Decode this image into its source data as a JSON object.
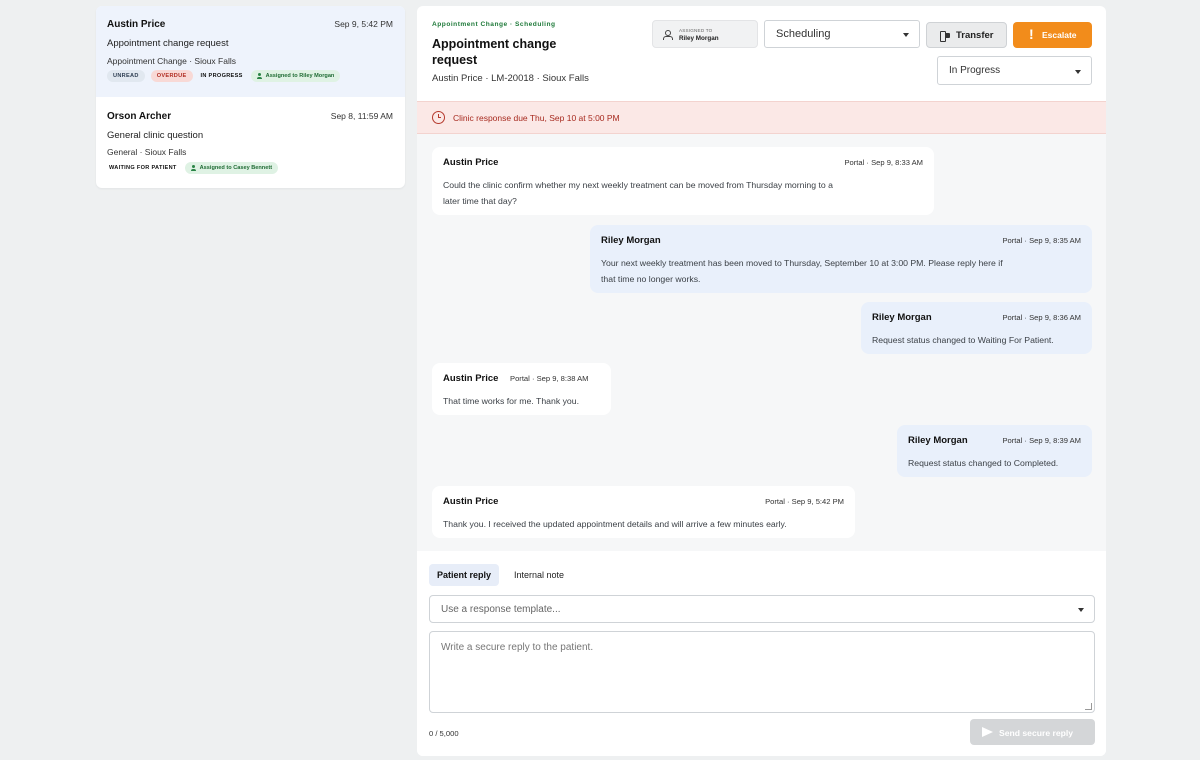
{
  "conversations": [
    {
      "name": "Austin Price",
      "time": "Sep 9, 5:42 PM",
      "subject": "Appointment change request",
      "meta": "Appointment Change · Sioux Falls",
      "badges": {
        "unread": "UNREAD",
        "overdue": "OVERDUE",
        "status": "IN PROGRESS",
        "assigned": "Assigned to Riley Morgan"
      }
    },
    {
      "name": "Orson Archer",
      "time": "Sep 8, 11:59 AM",
      "subject": "General clinic question",
      "meta": "General · Sioux Falls",
      "badges": {
        "status": "WAITING FOR PATIENT",
        "assigned": "Assigned to Casey Bennett"
      }
    }
  ],
  "header": {
    "category": "Appointment Change · Scheduling",
    "title": "Appointment change request",
    "patient": "Austin Price",
    "record": "LM-20018",
    "location": "Sioux Falls",
    "assigned_label": "ASSIGNED TO",
    "assigned_value": "Riley Morgan",
    "queue_value": "Scheduling",
    "transfer_label": "Transfer",
    "escalate_label": "Escalate",
    "status_value": "In Progress"
  },
  "alert": {
    "text": "Clinic response due Thu, Sep 10 at 5:00 PM"
  },
  "messages": [
    {
      "from": "Austin Price",
      "when": "Portal · Sep 9, 8:33 AM",
      "lines": [
        "Could the clinic confirm whether my next weekly treatment can be moved from Thursday morning to a",
        "later time that day?"
      ]
    },
    {
      "from": "Riley Morgan",
      "when": "Portal · Sep 9, 8:35 AM",
      "lines": [
        "Your next weekly treatment has been moved to Thursday, September 10 at 3:00 PM. Please reply here if",
        "that time no longer works."
      ]
    },
    {
      "from": "Riley Morgan",
      "when": "Portal · Sep 9, 8:36 AM",
      "lines": [
        "Request status changed to Waiting For Patient."
      ]
    },
    {
      "from": "Austin Price",
      "when": "Portal · Sep 9, 8:38 AM",
      "lines": [
        "That time works for me. Thank you."
      ]
    },
    {
      "from": "Riley Morgan",
      "when": "Portal · Sep 9, 8:39 AM",
      "lines": [
        "Request status changed to Completed."
      ]
    },
    {
      "from": "Austin Price",
      "when": "Portal · Sep 9, 5:42 PM",
      "lines": [
        "Thank you. I received the updated appointment details and will arrive a few minutes early."
      ]
    }
  ],
  "composer": {
    "tab_patient": "Patient reply",
    "tab_internal": "Internal note",
    "template_placeholder": "Use a response template...",
    "reply_placeholder": "Write a secure reply to the patient.",
    "counter": "0 / 5,000",
    "send_label": "Send secure reply"
  }
}
